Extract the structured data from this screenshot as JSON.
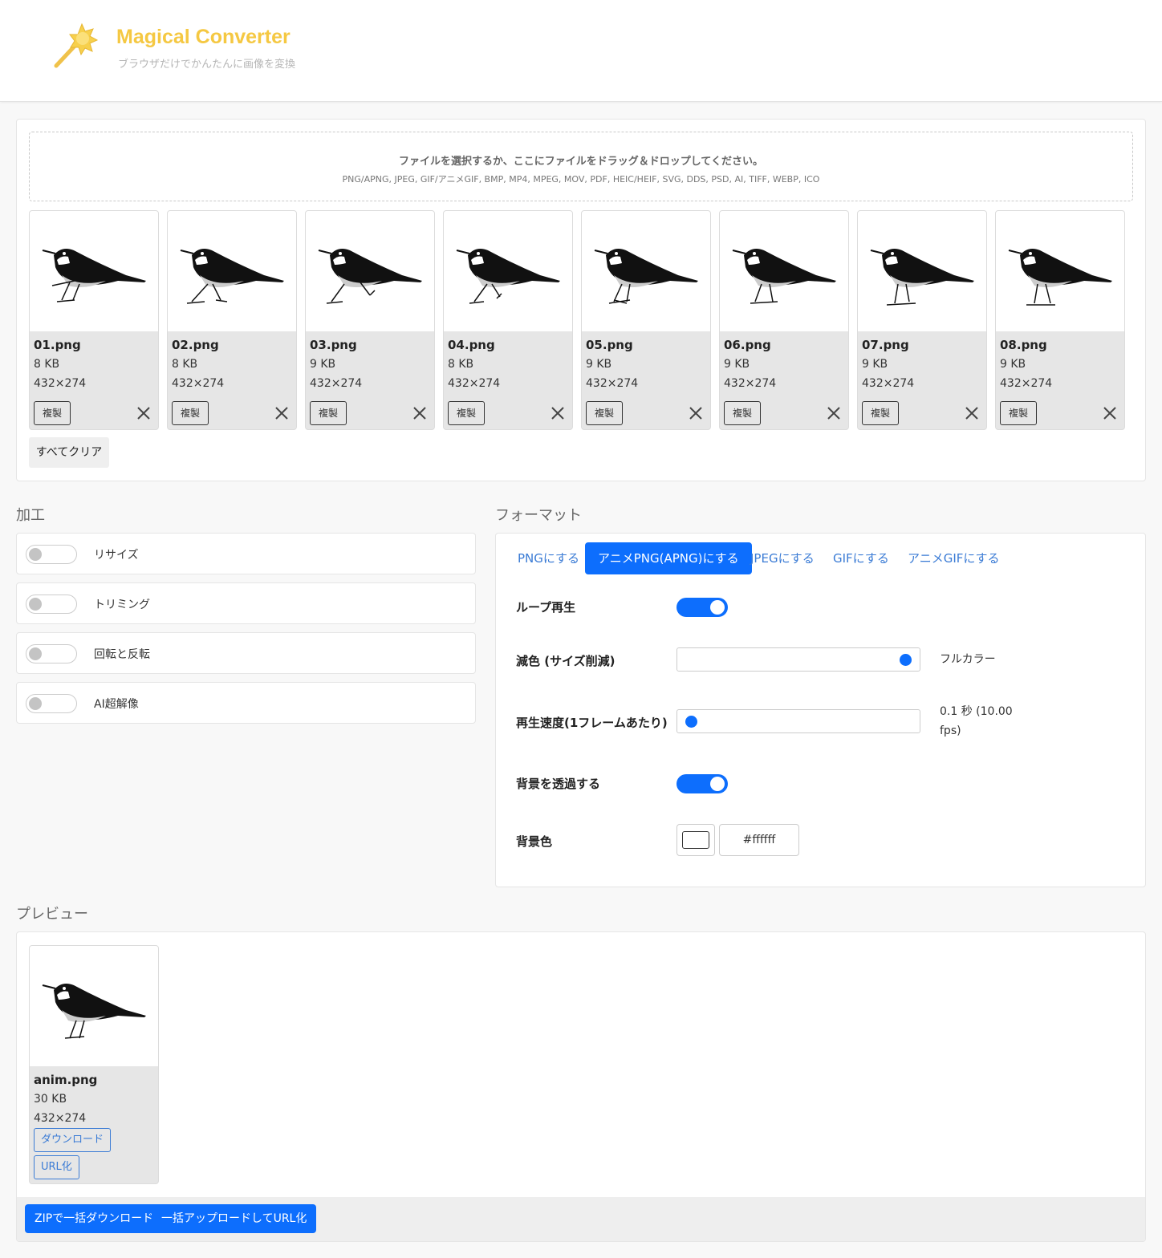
{
  "header": {
    "title": "Magical Converter",
    "subtitle": "ブラウザだけでかんたんに画像を変換"
  },
  "upload": {
    "dropzone_text": "ファイルを選択するか、ここにファイルをドラッグ＆ドロップしてください。",
    "formats": "PNG/APNG, JPEG, GIF/アニメGIF, BMP, MP4, MPEG, MOV, PDF, HEIC/HEIF, SVG, DDS, PSD, AI, TIFF, WEBP, ICO",
    "clear_all_label": "すべてクリア",
    "files": [
      {
        "name": "01.png",
        "size": "8 KB",
        "dims": "432×274",
        "dup_label": "複製"
      },
      {
        "name": "02.png",
        "size": "8 KB",
        "dims": "432×274",
        "dup_label": "複製"
      },
      {
        "name": "03.png",
        "size": "9 KB",
        "dims": "432×274",
        "dup_label": "複製"
      },
      {
        "name": "04.png",
        "size": "8 KB",
        "dims": "432×274",
        "dup_label": "複製"
      },
      {
        "name": "05.png",
        "size": "9 KB",
        "dims": "432×274",
        "dup_label": "複製"
      },
      {
        "name": "06.png",
        "size": "9 KB",
        "dims": "432×274",
        "dup_label": "複製"
      },
      {
        "name": "07.png",
        "size": "9 KB",
        "dims": "432×274",
        "dup_label": "複製"
      },
      {
        "name": "08.png",
        "size": "9 KB",
        "dims": "432×274",
        "dup_label": "複製"
      }
    ]
  },
  "processing": {
    "heading": "加工",
    "options": [
      {
        "label": "リサイズ",
        "enabled": false
      },
      {
        "label": "トリミング",
        "enabled": false
      },
      {
        "label": "回転と反転",
        "enabled": false
      },
      {
        "label": "AI超解像",
        "enabled": false
      }
    ]
  },
  "format": {
    "heading": "フォーマット",
    "tabs": [
      "PNGにする",
      "アニメPNG(APNG)にする",
      "JPEGにする",
      "GIFにする",
      "アニメGIFにする"
    ],
    "active_tab": "アニメPNG(APNG)にする",
    "loop_label": "ループ再生",
    "loop_enabled": true,
    "color_reduce_label": "減色 (サイズ削減)",
    "color_reduce_value": "フルカラー",
    "color_reduce_level": 1.0,
    "speed_label": "再生速度(1フレームあたり)",
    "speed_value_line1": "0.1 秒 (10.00",
    "speed_value_line2": "fps)",
    "speed_level": 0.0,
    "transparent_label": "背景を透過する",
    "transparent_enabled": true,
    "bg_color_label": "背景色",
    "bg_color_value": "#ffffff"
  },
  "preview": {
    "heading": "プレビュー",
    "file": {
      "name": "anim.png",
      "size": "30 KB",
      "dims": "432×274"
    },
    "download_label": "ダウンロード",
    "url_label": "URL化",
    "zip_label": "ZIPで一括ダウンロード",
    "bulk_upload_label": "一括アップロードしてURL化"
  },
  "colors": {
    "accent": "#0d6efd",
    "brand_yellow": "#f5c842"
  },
  "icons": [
    "magic-wand-icon",
    "bird-thumbnail",
    "close-icon"
  ]
}
